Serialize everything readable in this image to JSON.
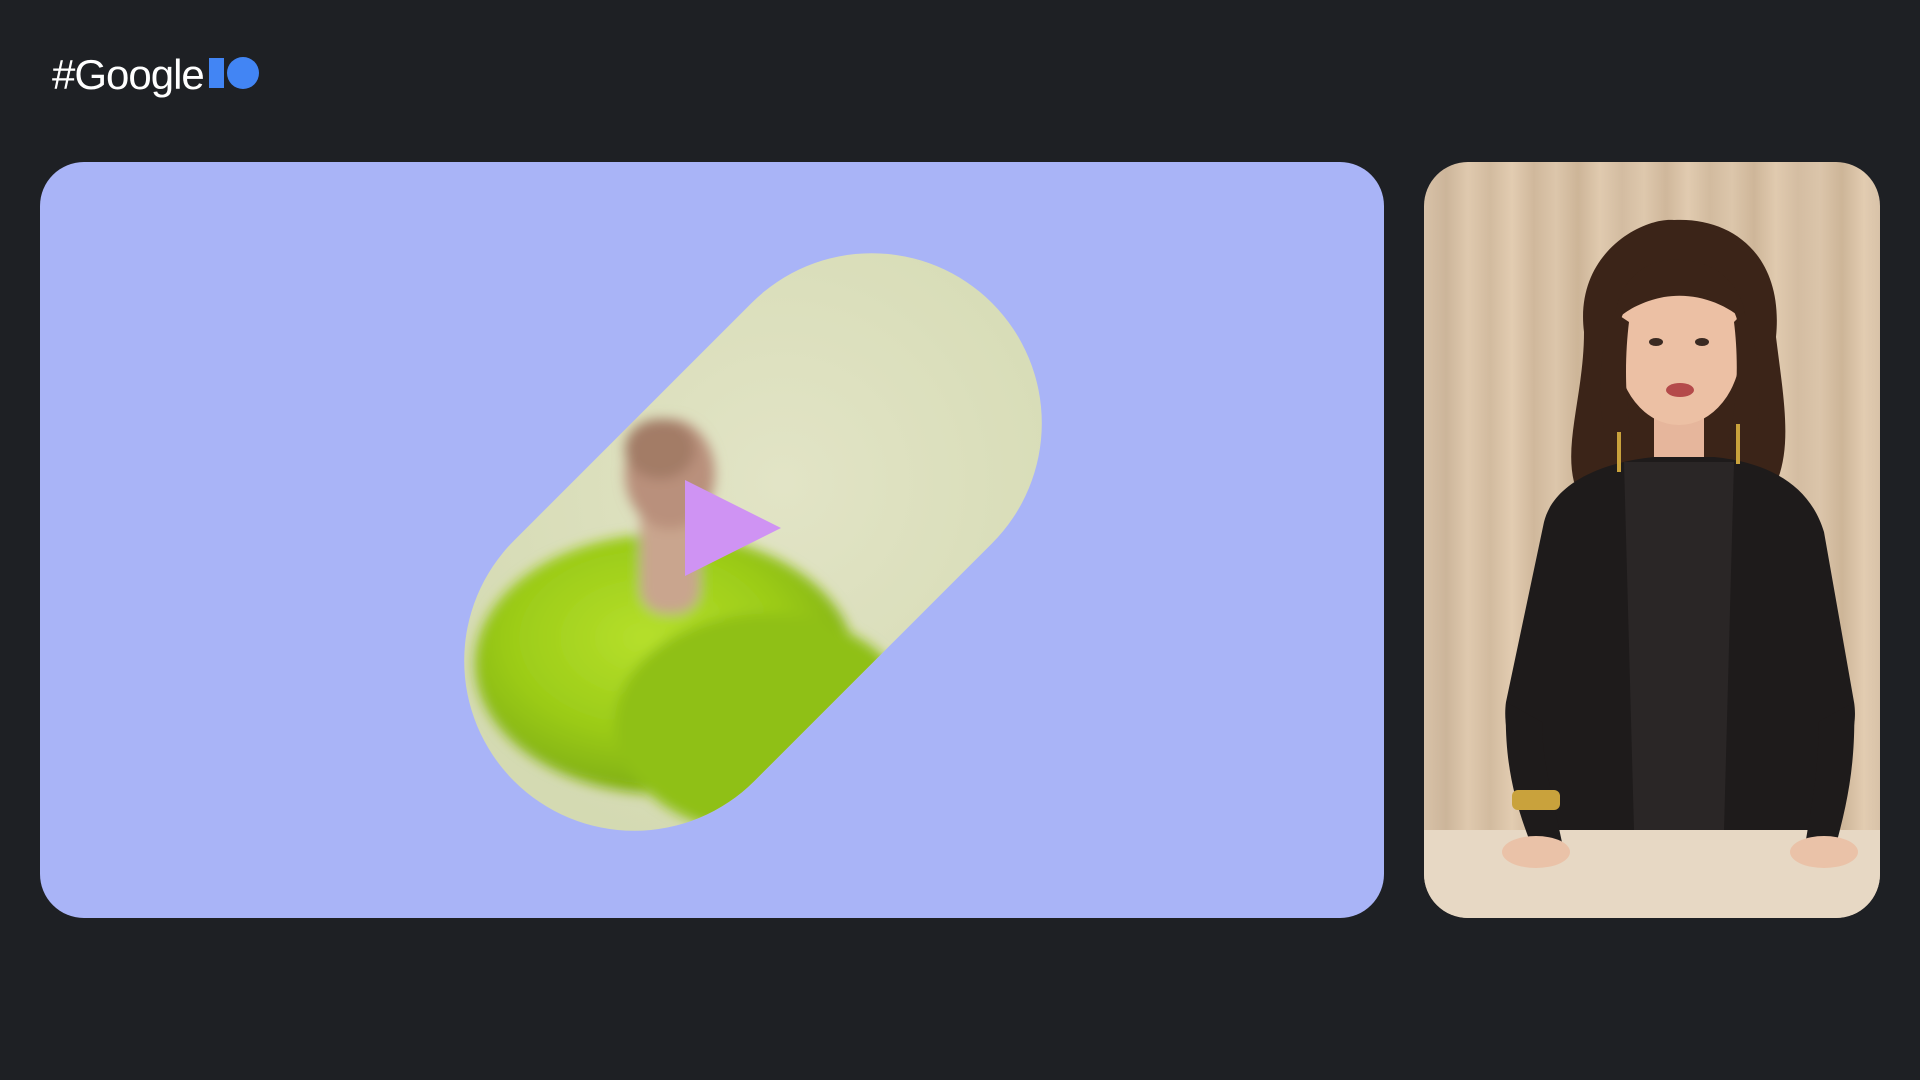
{
  "header": {
    "logo_text": "#Google",
    "logo_mark": "io-mark-icon",
    "brand_color": "#4285f4"
  },
  "slide": {
    "background_color": "#a9b4f7",
    "capsule_color": "#dce0bd",
    "accent_color": "#cf93f3",
    "play_icon": "play-triangle-icon"
  },
  "speaker_video": {
    "backdrop_color": "#d8c2a8",
    "desk_color": "#e7d8c4"
  },
  "page_background": "#1e2024"
}
